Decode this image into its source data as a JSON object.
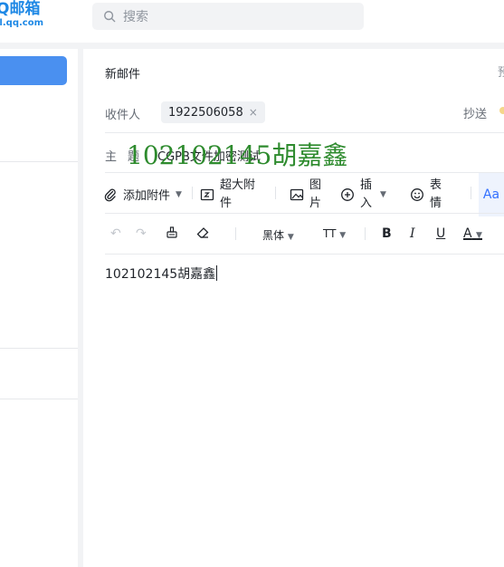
{
  "header": {
    "logo_line1": "Q邮箱",
    "logo_line2": "il.qq.com",
    "search_placeholder": "搜索"
  },
  "compose": {
    "title": "新邮件",
    "title_right": "预",
    "to_label": "收件人",
    "recipient": "1922506058",
    "recipient_remove": "×",
    "cc_label": "抄送",
    "subject_label": "主题",
    "subject_value": "CGPB文件加密测试",
    "handwritten_overlay": "102102145胡嘉鑫",
    "toolbar": {
      "attach": "添加附件",
      "large_attach": "超大附件",
      "image": "图片",
      "insert": "插入",
      "emoji": "表情",
      "font_style": "Aa"
    },
    "format": {
      "font_family": "黑体",
      "font_size": "TT",
      "bold": "B",
      "italic": "I",
      "underline": "U",
      "color": "A"
    },
    "body_text": "102102145胡嘉鑫"
  },
  "colors": {
    "accent": "#4a90f0",
    "handwriting": "#2e8b2e"
  }
}
